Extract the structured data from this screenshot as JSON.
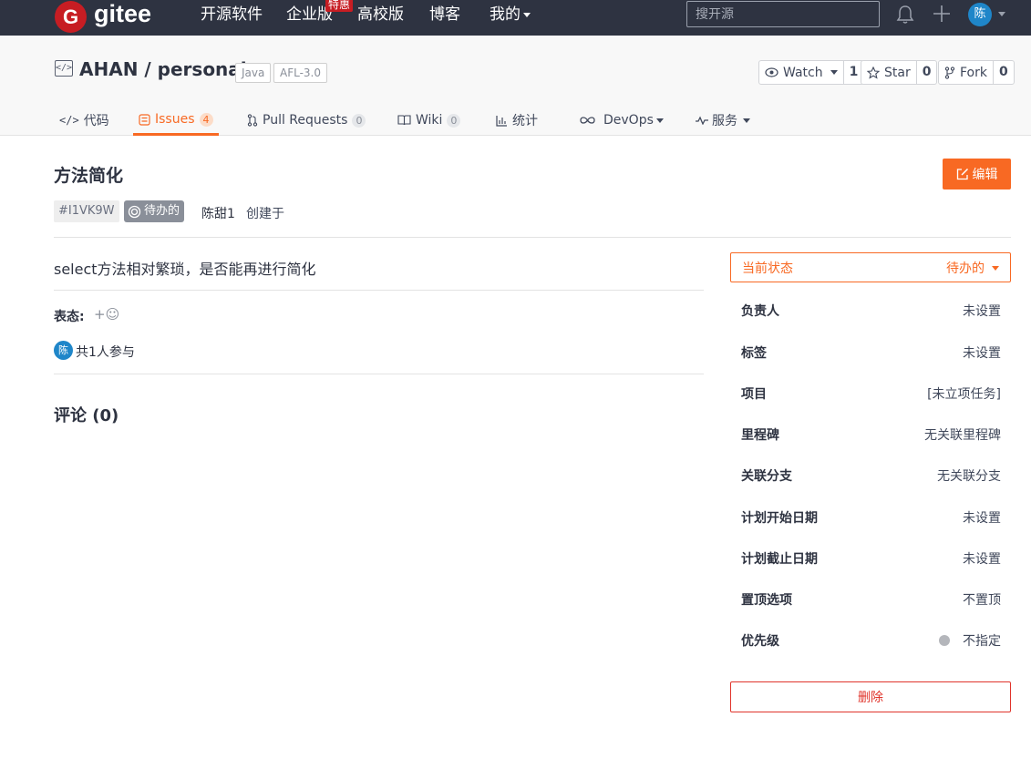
{
  "topnav": {
    "logo_letter": "G",
    "brand": "gitee",
    "items": [
      "开源软件",
      "企业版",
      "高校版",
      "博客",
      "我的"
    ],
    "badge": "特惠",
    "search_placeholder": "搜开源",
    "avatar": "陈"
  },
  "repo": {
    "icon": "</>",
    "title": "AHAN / personal",
    "tags": [
      "Java",
      "AFL-3.0"
    ],
    "watch": {
      "label": "Watch",
      "count": "1"
    },
    "star": {
      "label": "Star",
      "count": "0"
    },
    "fork": {
      "label": "Fork",
      "count": "0"
    }
  },
  "tabs": [
    {
      "label": "代码"
    },
    {
      "label": "Issues",
      "count": "4"
    },
    {
      "label": "Pull Requests",
      "count": "0"
    },
    {
      "label": "Wiki",
      "count": "0"
    },
    {
      "label": "统计"
    },
    {
      "label": "DevOps"
    },
    {
      "label": "服务"
    }
  ],
  "issue": {
    "title": "方法简化",
    "edit_label": "编辑",
    "id": "#I1VK9W",
    "state": "待办的",
    "author": "陈甜1",
    "created": "创建于",
    "description": "select方法相对繁琐，是否能再进行简化",
    "reaction_label": "表态:",
    "reaction_add": "+☺",
    "participant_avatar": "陈",
    "participants": "共1人参与",
    "comments": "评论 (0)"
  },
  "sidebar": {
    "status_label": "当前状态",
    "status_value": "待办的",
    "fields": [
      {
        "key": "负责人",
        "value": "未设置"
      },
      {
        "key": "标签",
        "value": "未设置"
      },
      {
        "key": "项目",
        "value": "[未立项任务]"
      },
      {
        "key": "里程碑",
        "value": "无关联里程碑"
      },
      {
        "key": "关联分支",
        "value": "无关联分支"
      },
      {
        "key": "计划开始日期",
        "value": "未设置"
      },
      {
        "key": "计划截止日期",
        "value": "未设置"
      },
      {
        "key": "置顶选项",
        "value": "不置顶"
      },
      {
        "key": "优先级",
        "value": "不指定"
      }
    ],
    "delete_label": "删除"
  }
}
